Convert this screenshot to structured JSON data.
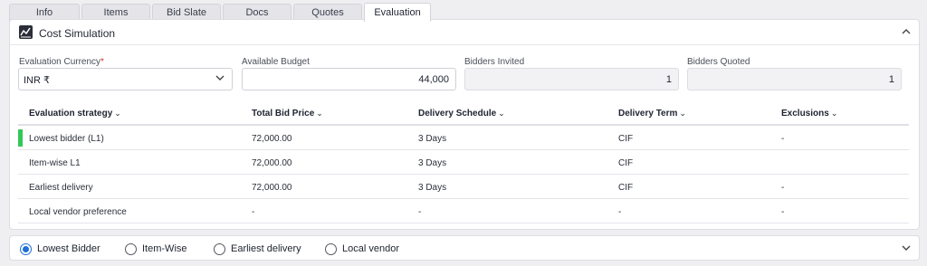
{
  "tabs": [
    {
      "label": "Info"
    },
    {
      "label": "Items"
    },
    {
      "label": "Bid Slate"
    },
    {
      "label": "Docs"
    },
    {
      "label": "Quotes"
    },
    {
      "label": "Evaluation",
      "active": true
    }
  ],
  "panel": {
    "title": "Cost Simulation",
    "icon": "chart-line-icon",
    "collapse_icon": "chevron-up-icon"
  },
  "fields": {
    "currency": {
      "label": "Evaluation Currency",
      "required_mark": "*",
      "value": "INR ₹"
    },
    "budget": {
      "label": "Available Budget",
      "value": "44,000"
    },
    "invited": {
      "label": "Bidders Invited",
      "value": "1"
    },
    "quoted": {
      "label": "Bidders Quoted",
      "value": "1"
    }
  },
  "table": {
    "headers": [
      "Evaluation strategy",
      "Total Bid Price",
      "Delivery Schedule",
      "Delivery Term",
      "Exclusions"
    ],
    "rows": [
      {
        "strategy": "Lowest bidder (L1)",
        "price": "72,000.00",
        "schedule": "3 Days",
        "term": "CIF",
        "exclusions": "-",
        "selected": true
      },
      {
        "strategy": "Item-wise L1",
        "price": "72,000.00",
        "schedule": "3 Days",
        "term": "CIF",
        "exclusions": ""
      },
      {
        "strategy": "Earliest delivery",
        "price": "72,000.00",
        "schedule": "3 Days",
        "term": "CIF",
        "exclusions": "-"
      },
      {
        "strategy": "Local vendor preference",
        "price": "-",
        "schedule": "-",
        "term": "-",
        "exclusions": "-"
      }
    ]
  },
  "radios": [
    {
      "label": "Lowest Bidder",
      "checked": true
    },
    {
      "label": "Item-Wise",
      "checked": false
    },
    {
      "label": "Earliest delivery",
      "checked": false
    },
    {
      "label": "Local vendor",
      "checked": false
    }
  ],
  "colors": {
    "selected_row_marker": "#34c759",
    "radio_accent": "#1f6fd6"
  }
}
